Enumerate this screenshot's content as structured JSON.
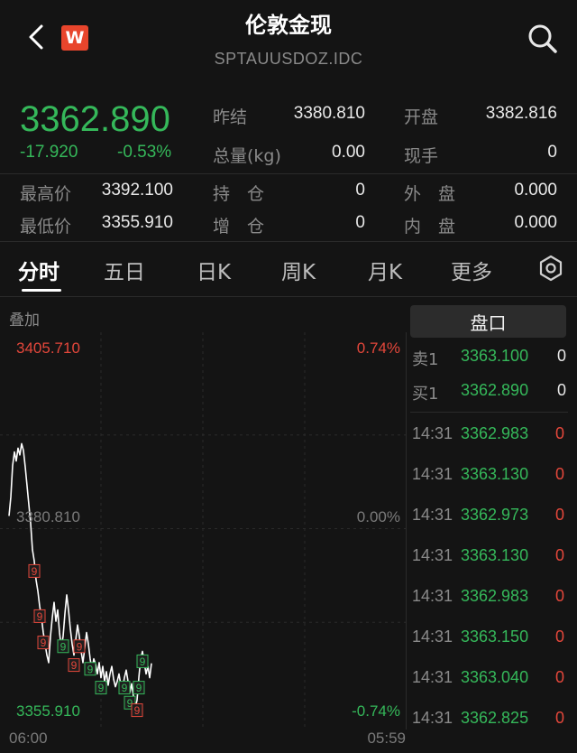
{
  "header": {
    "title": "伦敦金现",
    "subtitle": "SPTAUUSDOZ.IDC",
    "logo_letter": "W"
  },
  "quote": {
    "price": "3362.890",
    "change": "-17.920",
    "change_pct": "-0.53%",
    "fields": [
      {
        "label": "昨结",
        "value": "3380.810"
      },
      {
        "label": "开盘",
        "value": "3382.816"
      },
      {
        "label": "总量(kg)",
        "value": "0.00"
      },
      {
        "label": "现手",
        "value": "0"
      },
      {
        "label": "最高价",
        "value": "3392.100"
      },
      {
        "label": "持　仓",
        "value": "0"
      },
      {
        "label": "外　盘",
        "value": "0.000"
      },
      {
        "label": "最低价",
        "value": "3355.910"
      },
      {
        "label": "增　仓",
        "value": "0"
      },
      {
        "label": "内　盘",
        "value": "0.000"
      }
    ]
  },
  "tabs": [
    "分时",
    "五日",
    "日K",
    "周K",
    "月K",
    "更多"
  ],
  "chart": {
    "overlay_label": "叠加",
    "top_price": "3405.710",
    "top_pct": "0.74%",
    "mid_price": "3380.810",
    "mid_pct": "0.00%",
    "bottom_price": "3355.910",
    "bottom_pct": "-0.74%",
    "start_time": "06:00",
    "end_time": "05:59"
  },
  "chart_data": {
    "type": "line",
    "ylim": [
      3355.91,
      3405.71
    ],
    "x": [
      0,
      1,
      2,
      3,
      4,
      5,
      6,
      7,
      8,
      9,
      10,
      11,
      12,
      13,
      14,
      15,
      16,
      17,
      18,
      19,
      20,
      21,
      22,
      23,
      24,
      25,
      26,
      27,
      28,
      29,
      30,
      31,
      32,
      33,
      34,
      35,
      36,
      37,
      38,
      39,
      40,
      41,
      42,
      43,
      44,
      45,
      46,
      47,
      48,
      49,
      50,
      51,
      52,
      53,
      54,
      55,
      56,
      57,
      58,
      59,
      60,
      61,
      62,
      63,
      64,
      65,
      66,
      67,
      68,
      69,
      70,
      71,
      72,
      73,
      74,
      75,
      76,
      77,
      78,
      79
    ],
    "values": [
      3382.5,
      3385.0,
      3389.2,
      3391.0,
      3389.8,
      3391.5,
      3390.6,
      3392.1,
      3391.2,
      3389.0,
      3386.5,
      3384.0,
      3381.5,
      3378.0,
      3376.5,
      3374.0,
      3372.5,
      3370.5,
      3369.0,
      3367.0,
      3365.5,
      3364.0,
      3363.0,
      3366.5,
      3369.0,
      3371.0,
      3368.5,
      3370.0,
      3367.0,
      3365.0,
      3366.5,
      3369.5,
      3372.0,
      3370.0,
      3367.5,
      3365.5,
      3364.0,
      3366.0,
      3368.0,
      3366.5,
      3364.5,
      3363.0,
      3365.0,
      3367.0,
      3365.5,
      3363.5,
      3362.0,
      3363.5,
      3362.8,
      3361.5,
      3363.0,
      3361.0,
      3362.5,
      3360.5,
      3361.8,
      3360.0,
      3361.5,
      3362.5,
      3360.8,
      3359.8,
      3360.5,
      3361.5,
      3360.0,
      3359.5,
      3361.0,
      3362.0,
      3360.5,
      3359.0,
      3360.2,
      3358.5,
      3357.0,
      3358.0,
      3361.0,
      3363.5,
      3364.5,
      3363.0,
      3361.5,
      3362.5,
      3361.0,
      3362.9
    ],
    "markers": [
      {
        "x": 14,
        "label": "9",
        "color": "#e4473b"
      },
      {
        "x": 17,
        "label": "9",
        "color": "#e4473b"
      },
      {
        "x": 19,
        "label": "9",
        "color": "#e4473b"
      },
      {
        "x": 30,
        "label": "9",
        "color": "#35b85a"
      },
      {
        "x": 36,
        "label": "9",
        "color": "#e4473b"
      },
      {
        "x": 39,
        "label": "9",
        "color": "#e4473b"
      },
      {
        "x": 45,
        "label": "9",
        "color": "#35b85a"
      },
      {
        "x": 51,
        "label": "9",
        "color": "#35b85a"
      },
      {
        "x": 64,
        "label": "9",
        "color": "#35b85a"
      },
      {
        "x": 67,
        "label": "9",
        "color": "#35b85a"
      },
      {
        "x": 71,
        "label": "9",
        "color": "#e4473b"
      },
      {
        "x": 72,
        "label": "9",
        "color": "#35b85a"
      },
      {
        "x": 74,
        "label": "9",
        "color": "#35b85a"
      }
    ],
    "line_color": "#ffffff"
  },
  "orderbook": {
    "title": "盘口",
    "rows": [
      {
        "label": "卖1",
        "price": "3363.100",
        "qty": "0"
      },
      {
        "label": "买1",
        "price": "3362.890",
        "qty": "0"
      }
    ]
  },
  "ticks": [
    {
      "time": "14:31",
      "price": "3362.983",
      "qty": "0"
    },
    {
      "time": "14:31",
      "price": "3363.130",
      "qty": "0"
    },
    {
      "time": "14:31",
      "price": "3362.973",
      "qty": "0"
    },
    {
      "time": "14:31",
      "price": "3363.130",
      "qty": "0"
    },
    {
      "time": "14:31",
      "price": "3362.983",
      "qty": "0"
    },
    {
      "time": "14:31",
      "price": "3363.150",
      "qty": "0"
    },
    {
      "time": "14:31",
      "price": "3363.040",
      "qty": "0"
    },
    {
      "time": "14:31",
      "price": "3362.825",
      "qty": "0"
    }
  ],
  "colors": {
    "up": "#e4473b",
    "down": "#35b85a",
    "bg": "#141414"
  },
  "icons": [
    "back-arrow-icon",
    "search-icon",
    "settings-icon"
  ]
}
